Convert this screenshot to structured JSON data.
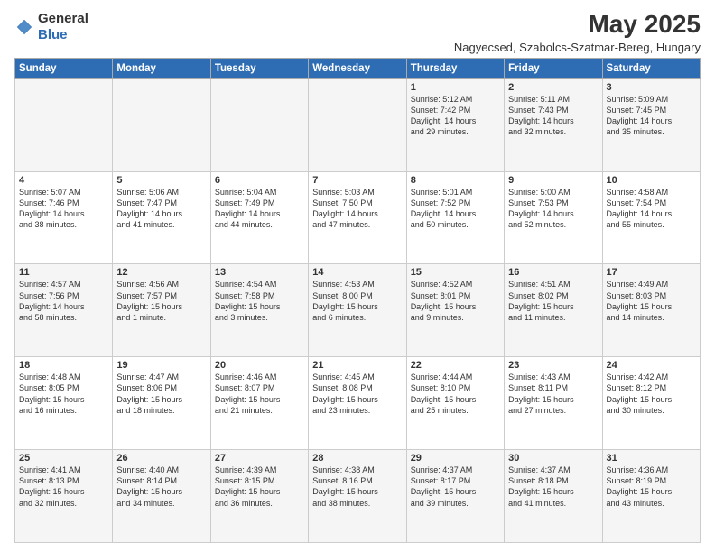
{
  "header": {
    "logo_general": "General",
    "logo_blue": "Blue",
    "month_title": "May 2025",
    "location": "Nagyecsed, Szabolcs-Szatmar-Bereg, Hungary"
  },
  "weekdays": [
    "Sunday",
    "Monday",
    "Tuesday",
    "Wednesday",
    "Thursday",
    "Friday",
    "Saturday"
  ],
  "weeks": [
    [
      {
        "day": "",
        "info": ""
      },
      {
        "day": "",
        "info": ""
      },
      {
        "day": "",
        "info": ""
      },
      {
        "day": "",
        "info": ""
      },
      {
        "day": "1",
        "info": "Sunrise: 5:12 AM\nSunset: 7:42 PM\nDaylight: 14 hours\nand 29 minutes."
      },
      {
        "day": "2",
        "info": "Sunrise: 5:11 AM\nSunset: 7:43 PM\nDaylight: 14 hours\nand 32 minutes."
      },
      {
        "day": "3",
        "info": "Sunrise: 5:09 AM\nSunset: 7:45 PM\nDaylight: 14 hours\nand 35 minutes."
      }
    ],
    [
      {
        "day": "4",
        "info": "Sunrise: 5:07 AM\nSunset: 7:46 PM\nDaylight: 14 hours\nand 38 minutes."
      },
      {
        "day": "5",
        "info": "Sunrise: 5:06 AM\nSunset: 7:47 PM\nDaylight: 14 hours\nand 41 minutes."
      },
      {
        "day": "6",
        "info": "Sunrise: 5:04 AM\nSunset: 7:49 PM\nDaylight: 14 hours\nand 44 minutes."
      },
      {
        "day": "7",
        "info": "Sunrise: 5:03 AM\nSunset: 7:50 PM\nDaylight: 14 hours\nand 47 minutes."
      },
      {
        "day": "8",
        "info": "Sunrise: 5:01 AM\nSunset: 7:52 PM\nDaylight: 14 hours\nand 50 minutes."
      },
      {
        "day": "9",
        "info": "Sunrise: 5:00 AM\nSunset: 7:53 PM\nDaylight: 14 hours\nand 52 minutes."
      },
      {
        "day": "10",
        "info": "Sunrise: 4:58 AM\nSunset: 7:54 PM\nDaylight: 14 hours\nand 55 minutes."
      }
    ],
    [
      {
        "day": "11",
        "info": "Sunrise: 4:57 AM\nSunset: 7:56 PM\nDaylight: 14 hours\nand 58 minutes."
      },
      {
        "day": "12",
        "info": "Sunrise: 4:56 AM\nSunset: 7:57 PM\nDaylight: 15 hours\nand 1 minute."
      },
      {
        "day": "13",
        "info": "Sunrise: 4:54 AM\nSunset: 7:58 PM\nDaylight: 15 hours\nand 3 minutes."
      },
      {
        "day": "14",
        "info": "Sunrise: 4:53 AM\nSunset: 8:00 PM\nDaylight: 15 hours\nand 6 minutes."
      },
      {
        "day": "15",
        "info": "Sunrise: 4:52 AM\nSunset: 8:01 PM\nDaylight: 15 hours\nand 9 minutes."
      },
      {
        "day": "16",
        "info": "Sunrise: 4:51 AM\nSunset: 8:02 PM\nDaylight: 15 hours\nand 11 minutes."
      },
      {
        "day": "17",
        "info": "Sunrise: 4:49 AM\nSunset: 8:03 PM\nDaylight: 15 hours\nand 14 minutes."
      }
    ],
    [
      {
        "day": "18",
        "info": "Sunrise: 4:48 AM\nSunset: 8:05 PM\nDaylight: 15 hours\nand 16 minutes."
      },
      {
        "day": "19",
        "info": "Sunrise: 4:47 AM\nSunset: 8:06 PM\nDaylight: 15 hours\nand 18 minutes."
      },
      {
        "day": "20",
        "info": "Sunrise: 4:46 AM\nSunset: 8:07 PM\nDaylight: 15 hours\nand 21 minutes."
      },
      {
        "day": "21",
        "info": "Sunrise: 4:45 AM\nSunset: 8:08 PM\nDaylight: 15 hours\nand 23 minutes."
      },
      {
        "day": "22",
        "info": "Sunrise: 4:44 AM\nSunset: 8:10 PM\nDaylight: 15 hours\nand 25 minutes."
      },
      {
        "day": "23",
        "info": "Sunrise: 4:43 AM\nSunset: 8:11 PM\nDaylight: 15 hours\nand 27 minutes."
      },
      {
        "day": "24",
        "info": "Sunrise: 4:42 AM\nSunset: 8:12 PM\nDaylight: 15 hours\nand 30 minutes."
      }
    ],
    [
      {
        "day": "25",
        "info": "Sunrise: 4:41 AM\nSunset: 8:13 PM\nDaylight: 15 hours\nand 32 minutes."
      },
      {
        "day": "26",
        "info": "Sunrise: 4:40 AM\nSunset: 8:14 PM\nDaylight: 15 hours\nand 34 minutes."
      },
      {
        "day": "27",
        "info": "Sunrise: 4:39 AM\nSunset: 8:15 PM\nDaylight: 15 hours\nand 36 minutes."
      },
      {
        "day": "28",
        "info": "Sunrise: 4:38 AM\nSunset: 8:16 PM\nDaylight: 15 hours\nand 38 minutes."
      },
      {
        "day": "29",
        "info": "Sunrise: 4:37 AM\nSunset: 8:17 PM\nDaylight: 15 hours\nand 39 minutes."
      },
      {
        "day": "30",
        "info": "Sunrise: 4:37 AM\nSunset: 8:18 PM\nDaylight: 15 hours\nand 41 minutes."
      },
      {
        "day": "31",
        "info": "Sunrise: 4:36 AM\nSunset: 8:19 PM\nDaylight: 15 hours\nand 43 minutes."
      }
    ]
  ]
}
